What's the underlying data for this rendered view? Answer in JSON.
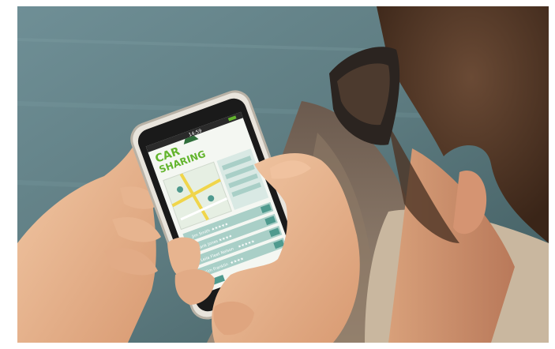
{
  "phone": {
    "status_time": "14:59",
    "logo_line1": "CAR",
    "logo_line2": "SHARING",
    "list_items": [
      {
        "name": "Jim Smith",
        "stars": "★★★★★"
      },
      {
        "name": "Frank Jones",
        "stars": "★★★★"
      },
      {
        "name": "Leila Fleet Nelson",
        "stars": "★★★★★"
      },
      {
        "name": "Kim Franklin",
        "stars": "★★★★"
      }
    ]
  },
  "colors": {
    "accent": "#63b52e",
    "panel": "#a9cfc7",
    "teal": "#4f9a8e"
  }
}
